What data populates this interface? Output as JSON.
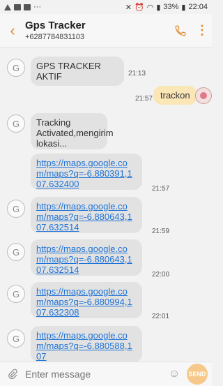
{
  "status_bar": {
    "battery_text": "33%",
    "time": "22:04"
  },
  "header": {
    "title": "Gps Tracker",
    "subtitle": "+6287784831103",
    "icons": {
      "back": "back-arrow-icon",
      "call": "phone-icon",
      "more": "more-vert-icon"
    }
  },
  "contact": {
    "avatar_letter": "G"
  },
  "messages": [
    {
      "direction": "in",
      "text": "GPS TRACKER AKTIF",
      "time": "21:13"
    },
    {
      "direction": "out",
      "text": "trackon",
      "time": "21:57"
    },
    {
      "direction": "in",
      "text": "Tracking Activated,mengirim lokasi...",
      "time": ""
    },
    {
      "direction": "in",
      "text": "https://maps.google.com/maps?q=-6.880391,107.632400",
      "time": "21:57"
    },
    {
      "direction": "in",
      "text": "https://maps.google.com/maps?q=-6.880643,107.632514",
      "time": "21:59"
    },
    {
      "direction": "in",
      "text": "https://maps.google.com/maps?q=-6.880643,107.632514",
      "time": "22:00"
    },
    {
      "direction": "in",
      "text": "https://maps.google.com/maps?q=-6.880994,107.632308",
      "time": "22:01"
    },
    {
      "direction": "in",
      "text": "https://maps.google.com/maps?q=-6.880588,107",
      "time": ""
    }
  ],
  "input": {
    "placeholder": "Enter message",
    "send_label": "SEND"
  },
  "colors": {
    "accent": "#e08a2e",
    "incoming_bubble": "#e2e2e2",
    "outgoing_bubble": "#fbe6b8",
    "link": "#1e73d8"
  }
}
